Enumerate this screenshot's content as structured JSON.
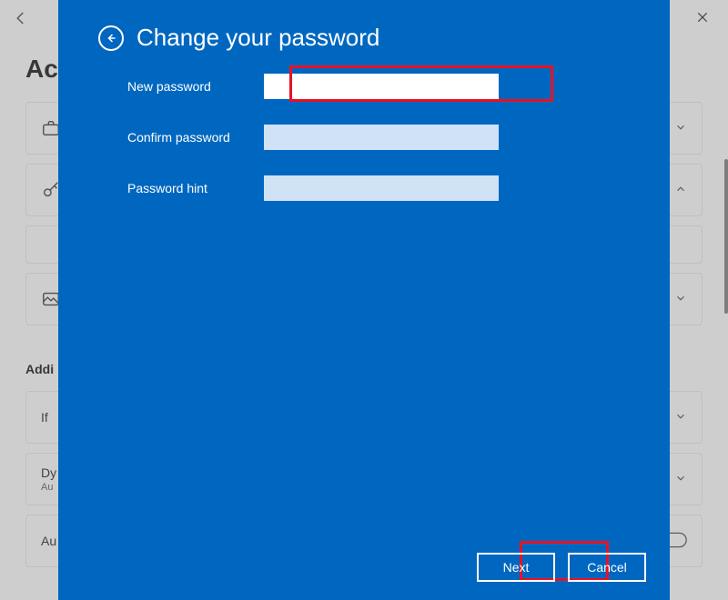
{
  "background": {
    "title_partial": "Ac",
    "subhead": "Addi",
    "items": {
      "if_label": "If",
      "dy_label": "Dy",
      "dy_sub": "Au",
      "au_label": "Au"
    }
  },
  "modal": {
    "title": "Change your password",
    "labels": {
      "new_password": "New password",
      "confirm_password": "Confirm password",
      "password_hint": "Password hint"
    },
    "values": {
      "new_password": "",
      "confirm_password": "",
      "password_hint": ""
    },
    "actions": {
      "next": "Next",
      "cancel": "Cancel"
    }
  },
  "colors": {
    "modal_bg": "#0067c0",
    "highlight": "#e81123",
    "input_inactive": "#cfe2f6"
  }
}
